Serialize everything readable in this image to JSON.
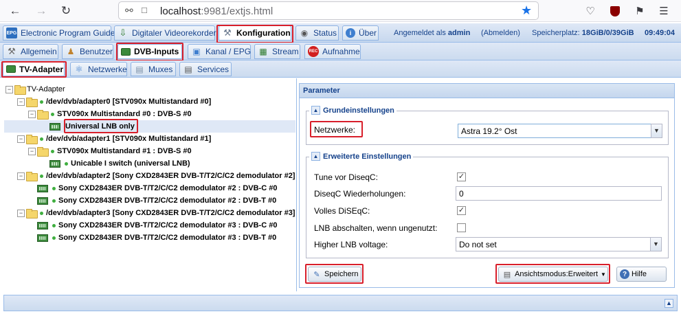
{
  "browser": {
    "url_host": "localhost",
    "url_path": ":9981/extjs.html"
  },
  "top_tabs": [
    {
      "label": "Electronic Program Guide"
    },
    {
      "label": "Digitaler Videorekorder"
    },
    {
      "label": "Konfiguration"
    },
    {
      "label": "Status"
    },
    {
      "label": "Über"
    }
  ],
  "top_info": {
    "logged_in_prefix": "Angemeldet als",
    "user": "admin",
    "logout": "(Abmelden)",
    "storage_label": "Speicherplatz:",
    "storage_value": "18GiB/0/39GiB",
    "time": "09:49:04"
  },
  "config_tabs": [
    {
      "label": "Allgemein"
    },
    {
      "label": "Benutzer"
    },
    {
      "label": "DVB-Inputs"
    },
    {
      "label": "Kanal / EPG"
    },
    {
      "label": "Stream"
    },
    {
      "label": "Aufnahme"
    }
  ],
  "dvb_tabs": [
    {
      "label": "TV-Adapter"
    },
    {
      "label": "Netzwerke"
    },
    {
      "label": "Muxes"
    },
    {
      "label": "Services"
    }
  ],
  "tree": [
    {
      "label": "TV-Adapter"
    },
    {
      "label": "/dev/dvb/adapter0 [STV090x Multistandard #0]"
    },
    {
      "label": "STV090x Multistandard #0 : DVB-S #0"
    },
    {
      "label": "Universal LNB only"
    },
    {
      "label": "/dev/dvb/adapter1 [STV090x Multistandard #1]"
    },
    {
      "label": "STV090x Multistandard #1 : DVB-S #0"
    },
    {
      "label": "Unicable I switch (universal LNB)"
    },
    {
      "label": "/dev/dvb/adapter2 [Sony CXD2843ER DVB-T/T2/C/C2 demodulator #2]"
    },
    {
      "label": "Sony CXD2843ER DVB-T/T2/C/C2 demodulator #2 : DVB-C #0"
    },
    {
      "label": "Sony CXD2843ER DVB-T/T2/C/C2 demodulator #2 : DVB-T #0"
    },
    {
      "label": "/dev/dvb/adapter3 [Sony CXD2843ER DVB-T/T2/C/C2 demodulator #3]"
    },
    {
      "label": "Sony CXD2843ER DVB-T/T2/C/C2 demodulator #3 : DVB-C #0"
    },
    {
      "label": "Sony CXD2843ER DVB-T/T2/C/C2 demodulator #3 : DVB-T #0"
    }
  ],
  "params": {
    "title": "Parameter",
    "basic": {
      "legend": "Grundeinstellungen",
      "networks_label": "Netzwerke:",
      "networks_value": "Astra 19.2° Ost"
    },
    "advanced": {
      "legend": "Erweiterte Einstellungen",
      "tune_label": "Tune vor DiseqC:",
      "tune_checked": true,
      "repeats_label": "DiseqC Wiederholungen:",
      "repeats_value": "0",
      "full_label": "Volles DiSEqC:",
      "full_checked": true,
      "lnb_off_label": "LNB abschalten, wenn ungenutzt:",
      "lnb_off_checked": false,
      "higher_voltage_label": "Higher LNB voltage:",
      "higher_voltage_value": "Do not set"
    },
    "buttons": {
      "save": "Speichern",
      "view_mode": "Ansichtsmodus:Erweitert",
      "help": "Hilfe"
    }
  }
}
